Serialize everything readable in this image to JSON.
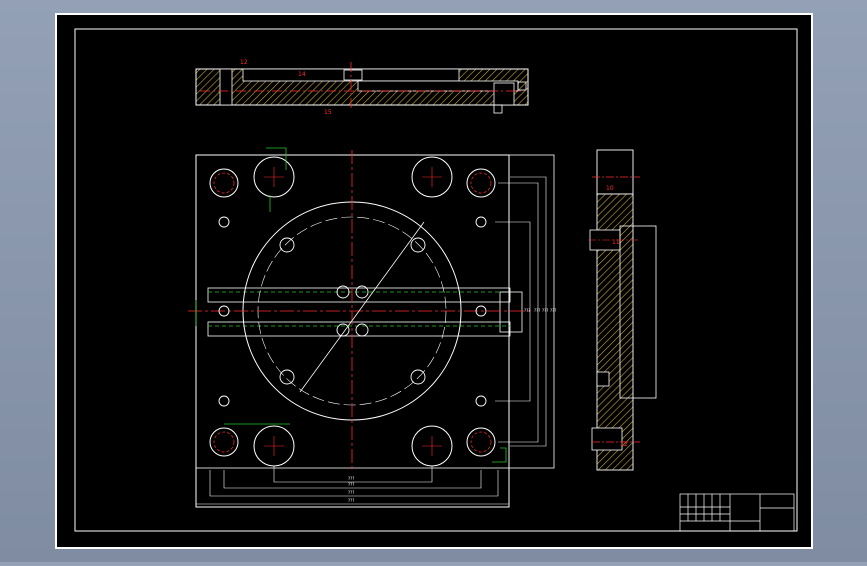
{
  "drawing": {
    "background_color": "#000000",
    "line_color": "#ffffff",
    "centerline_color": "#ff2a2a",
    "hatch_color": "#c8a832",
    "dim_color": "#27c427",
    "label_color": "#ff2a2a",
    "top_view_labels": [
      "12",
      "14",
      "15"
    ],
    "top_view_note": "",
    "plan_dims_horizontal": [
      "???",
      "???",
      "???",
      "???"
    ],
    "plan_dims_vertical": [
      "???",
      "???",
      "???",
      "???"
    ],
    "angle_label": "",
    "side_view_labels": [
      "10",
      "11",
      "12"
    ],
    "notes": [
      "",
      "",
      ""
    ],
    "corner_mark": "",
    "title_block": {
      "name": "",
      "drawing_no": "",
      "scale": "",
      "sheet": ""
    }
  }
}
